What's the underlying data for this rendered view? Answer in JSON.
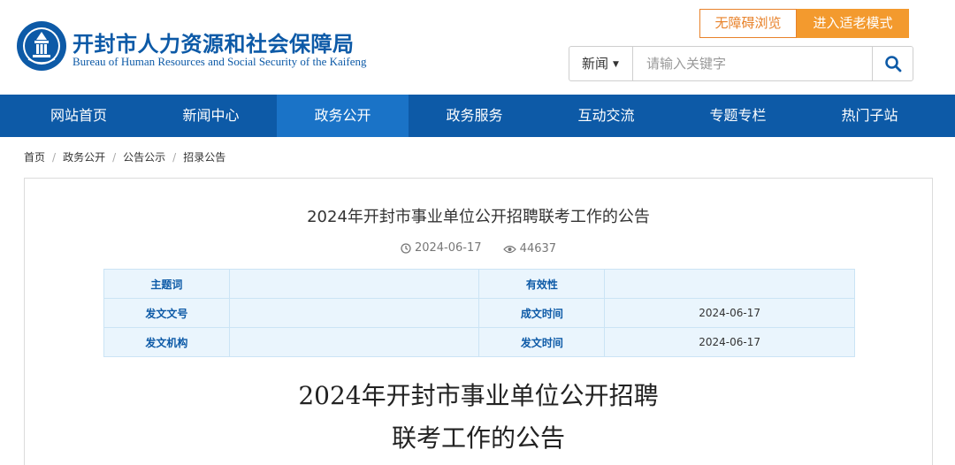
{
  "header": {
    "title": "开封市人力资源和社会保障局",
    "subtitle": "Bureau of Human Resources and Social Security of the Kaifeng",
    "accessibility_label": "无障碍浏览",
    "elder_mode_label": "进入适老模式"
  },
  "search": {
    "category": "新闻",
    "placeholder": "请输入关键字",
    "icon": "search-icon"
  },
  "nav": {
    "items": [
      {
        "label": "网站首页"
      },
      {
        "label": "新闻中心"
      },
      {
        "label": "政务公开"
      },
      {
        "label": "政务服务"
      },
      {
        "label": "互动交流"
      },
      {
        "label": "专题专栏"
      },
      {
        "label": "热门子站"
      }
    ],
    "active_index": 2
  },
  "breadcrumb": [
    "首页",
    "政务公开",
    "公告公示",
    "招录公告"
  ],
  "article": {
    "title": "2024年开封市事业单位公开招聘联考工作的公告",
    "date": "2024-06-17",
    "views": "44637",
    "info": {
      "keyword_label": "主题词",
      "keyword_value": "",
      "validity_label": "有效性",
      "validity_value": "",
      "doc_no_label": "发文文号",
      "doc_no_value": "",
      "created_label": "成文时间",
      "created_value": "2024-06-17",
      "org_label": "发文机构",
      "org_value": "",
      "published_label": "发文时间",
      "published_value": "2024-06-17"
    },
    "heading_line1": "2024年开封市事业单位公开招聘",
    "heading_line2": "联考工作的公告"
  },
  "colors": {
    "brand_blue": "#0d5aa7",
    "nav_active": "#1a73c7",
    "accent_orange": "#f39a2e"
  }
}
